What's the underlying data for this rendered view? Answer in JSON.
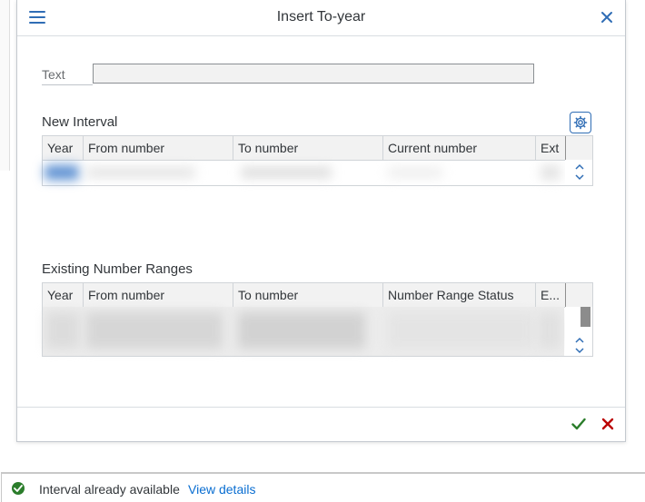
{
  "dialog": {
    "title": "Insert To-year",
    "icons": {
      "menu": "menu-icon",
      "close": "close-icon",
      "settings": "gear-icon",
      "ok": "checkmark-icon",
      "cancel": "cancel-icon"
    },
    "text_field": {
      "label": "Text",
      "value": ""
    }
  },
  "new_interval": {
    "title": "New Interval",
    "columns": [
      "Year",
      "From number",
      "To number",
      "Current number",
      "Ext"
    ]
  },
  "existing_ranges": {
    "title": "Existing Number Ranges",
    "columns": [
      "Year",
      "From number",
      "To number",
      "Number Range Status",
      "E..."
    ]
  },
  "status": {
    "message": "Interval already available",
    "link": "View details",
    "icon": "success-check-icon"
  },
  "colors": {
    "accent": "#2f6db5",
    "ok": "#2b7d2b",
    "cancel": "#bb0000",
    "link": "#0a6ed1"
  }
}
